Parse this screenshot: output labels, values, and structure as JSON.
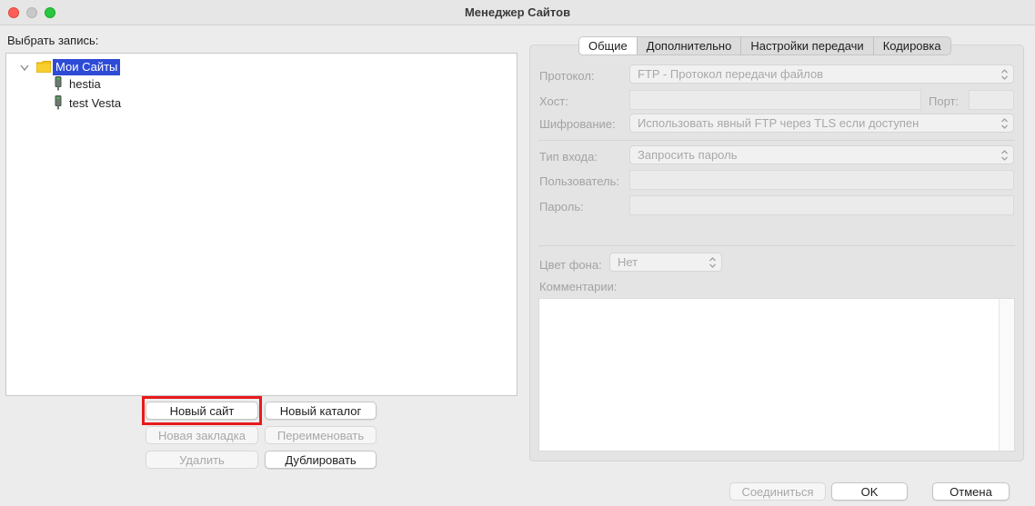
{
  "window": {
    "title": "Менеджер Сайтов"
  },
  "left": {
    "select_label": "Выбрать запись:",
    "tree": {
      "root": "Мои Сайты",
      "sites": [
        "hestia",
        "test Vesta"
      ]
    },
    "buttons": {
      "new_site": "Новый сайт",
      "new_folder": "Новый каталог",
      "new_bookmark": "Новая закладка",
      "rename": "Переименовать",
      "delete": "Удалить",
      "duplicate": "Дублировать"
    }
  },
  "tabs": [
    "Общие",
    "Дополнительно",
    "Настройки передачи",
    "Кодировка"
  ],
  "general": {
    "protocol_label": "Протокол:",
    "protocol_value": "FTP - Протокол передачи файлов",
    "host_label": "Хост:",
    "host_value": "",
    "port_label": "Порт:",
    "port_value": "",
    "encryption_label": "Шифрование:",
    "encryption_value": "Использовать явный FTP через TLS если доступен",
    "logon_label": "Тип входа:",
    "logon_value": "Запросить пароль",
    "user_label": "Пользователь:",
    "user_value": "",
    "password_label": "Пароль:",
    "password_value": "",
    "bgcolor_label": "Цвет фона:",
    "bgcolor_value": "Нет",
    "comments_label": "Комментарии:"
  },
  "footer": {
    "connect": "Соединиться",
    "ok": "OK",
    "cancel": "Отмена"
  },
  "colors": {
    "selection": "#2e4bd6",
    "highlight_box": "#e8191c",
    "folder": "#f5c518"
  }
}
